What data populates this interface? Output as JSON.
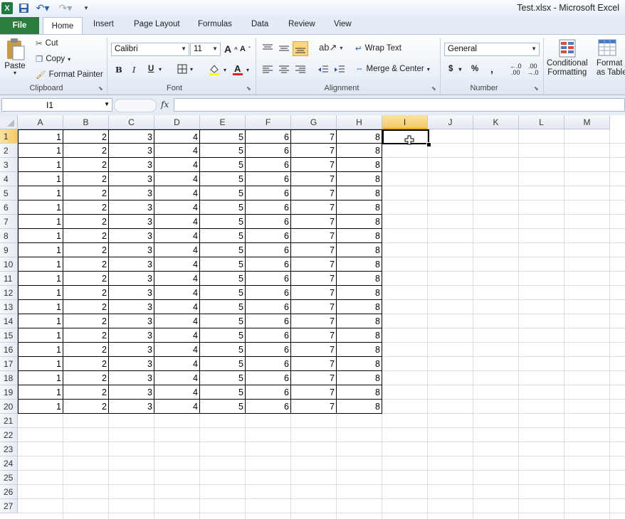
{
  "window": {
    "title": "Test.xlsx  -  Microsoft Excel"
  },
  "tabs": [
    "File",
    "Home",
    "Insert",
    "Page Layout",
    "Formulas",
    "Data",
    "Review",
    "View"
  ],
  "clipboard": {
    "paste": "Paste",
    "cut": "Cut",
    "copy": "Copy",
    "format_painter": "Format Painter",
    "label": "Clipboard"
  },
  "font": {
    "name": "Calibri",
    "size": "11",
    "label": "Font",
    "bold": "B",
    "italic": "I",
    "underline": "U"
  },
  "alignment": {
    "wrap_text": "Wrap Text",
    "merge_center": "Merge & Center",
    "label": "Alignment"
  },
  "number": {
    "format": "General",
    "currency": "$",
    "percent": "%",
    "comma": ",",
    "label": "Number"
  },
  "styles": {
    "conditional_formatting_1": "Conditional",
    "conditional_formatting_2": "Formatting",
    "format_table_1": "Format",
    "format_table_2": "as Table"
  },
  "formula_bar": {
    "name_box": "I1",
    "fx": "fx",
    "value": ""
  },
  "sheet": {
    "columns": [
      "A",
      "B",
      "C",
      "D",
      "E",
      "F",
      "G",
      "H",
      "I",
      "J",
      "K",
      "L",
      "M"
    ],
    "selected_column": "I",
    "selected_row": 1,
    "row_count_visible": 27,
    "data_rows": 20,
    "row_values": [
      1,
      2,
      3,
      4,
      5,
      6,
      7,
      8
    ]
  }
}
